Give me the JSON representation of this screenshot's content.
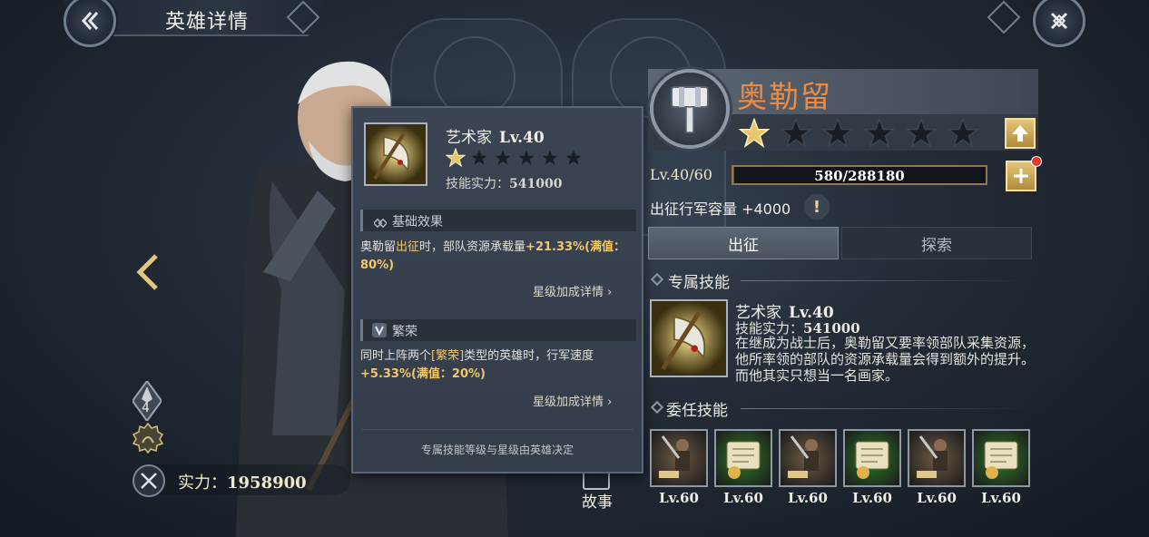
{
  "header": {
    "title": "英雄详情"
  },
  "hero": {
    "power_label": "实力：",
    "power_value": "1958900",
    "rank_number": "4",
    "name": "奥勒留",
    "stars_filled": 1,
    "stars_total": 6,
    "level_label": "Lv.40/60",
    "exp_text": "580/288180",
    "exp_fraction": 0.002,
    "capacity_text": "出征行军容量 +4000",
    "warn_symbol": "!"
  },
  "tabs": [
    {
      "label": "出征",
      "active": true
    },
    {
      "label": "探索",
      "active": false
    }
  ],
  "story": {
    "label": "故事"
  },
  "exclusive_skill": {
    "section_title": "专属技能",
    "name": "艺术家",
    "level": "Lv.40",
    "power_label": "技能实力：",
    "power_value": "541000",
    "description": "在继成为战士后，奥勒留又要率领部队采集资源，他所率领的部队的资源承载量会得到额外的提升。而他其实只想当一名画家。"
  },
  "popup": {
    "name": "艺术家",
    "level": "Lv.40",
    "stars_filled": 1,
    "stars_total": 6,
    "power_label": "技能实力：",
    "power_value": "541000",
    "basic_title": "基础效果",
    "basic_effect": {
      "p1": "奥勒留",
      "p2": "出征",
      "p3": "时，部队资源承载量",
      "p4": "+21.33%(满值：80%)"
    },
    "detail_link": "星级加成详情",
    "prosper_title": "繁荣",
    "prosper_effect": {
      "p1": "同时上阵两个",
      "p2": "[繁荣]",
      "p3": "类型的英雄时，行军速度",
      "p4": "+5.33%(满值：20%)"
    },
    "footer": "专属技能等级与星级由英雄决定"
  },
  "delegated_skills": {
    "section_title": "委任技能",
    "items": [
      {
        "icon": "wood-worker-icon",
        "level": "Lv.60",
        "bg": "#6d5a45"
      },
      {
        "icon": "wood-scroll-icon",
        "level": "Lv.60",
        "bg": "#2f7a2a"
      },
      {
        "icon": "wheat-worker-icon",
        "level": "Lv.60",
        "bg": "#6d5a45"
      },
      {
        "icon": "wheat-scroll-icon",
        "level": "Lv.60",
        "bg": "#2f7a2a"
      },
      {
        "icon": "stone-worker-icon",
        "level": "Lv.60",
        "bg": "#6d5a45"
      },
      {
        "icon": "coin-scroll-icon",
        "level": "Lv.60",
        "bg": "#2f7a2a"
      }
    ]
  },
  "colors": {
    "hero_name": "#f08a3d",
    "gold": "#e4c57a",
    "highlight": "#f3c76a",
    "star_gold": "#e8c46a",
    "star_empty": "#1a1e24"
  }
}
